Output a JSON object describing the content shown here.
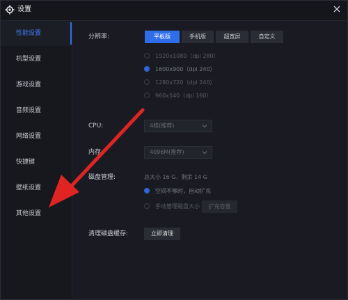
{
  "window": {
    "title": "设置"
  },
  "sidebar": {
    "items": [
      {
        "label": "性能设置",
        "active": true
      },
      {
        "label": "机型设置",
        "active": false
      },
      {
        "label": "游戏设置",
        "active": false
      },
      {
        "label": "音频设置",
        "active": false
      },
      {
        "label": "网络设置",
        "active": false
      },
      {
        "label": "快捷键",
        "active": false
      },
      {
        "label": "壁纸设置",
        "active": false
      },
      {
        "label": "其他设置",
        "active": false
      }
    ]
  },
  "resolution": {
    "label": "分辨率:",
    "tabs": [
      {
        "label": "平板版",
        "active": true
      },
      {
        "label": "手机版",
        "active": false
      },
      {
        "label": "超宽屏",
        "active": false
      },
      {
        "label": "自定义",
        "active": false
      }
    ],
    "options": [
      {
        "label": "1920x1080（dpi 280）",
        "selected": false
      },
      {
        "label": "1600x900（dpi 240）",
        "selected": true
      },
      {
        "label": "1280x720（dpi 240）",
        "selected": false
      },
      {
        "label": "960x540（dpi 160）",
        "selected": false
      }
    ]
  },
  "cpu": {
    "label": "CPU:",
    "value": "4核(推荐)"
  },
  "memory": {
    "label": "内存:",
    "value": "4096M(推荐)"
  },
  "disk": {
    "label": "磁盘管理:",
    "info": "总大小 16 G，剩余 14 G",
    "options": [
      {
        "label": "空间不够时，自动扩充",
        "selected": true
      },
      {
        "label": "手动管理磁盘大小",
        "selected": false
      }
    ],
    "expand_button": "扩充容量"
  },
  "cache": {
    "label": "清理磁盘缓存:",
    "button": "立即清理"
  },
  "colors": {
    "accent": "#2f6ee8",
    "arrow": "#e02424",
    "background": "#1a1b22"
  }
}
